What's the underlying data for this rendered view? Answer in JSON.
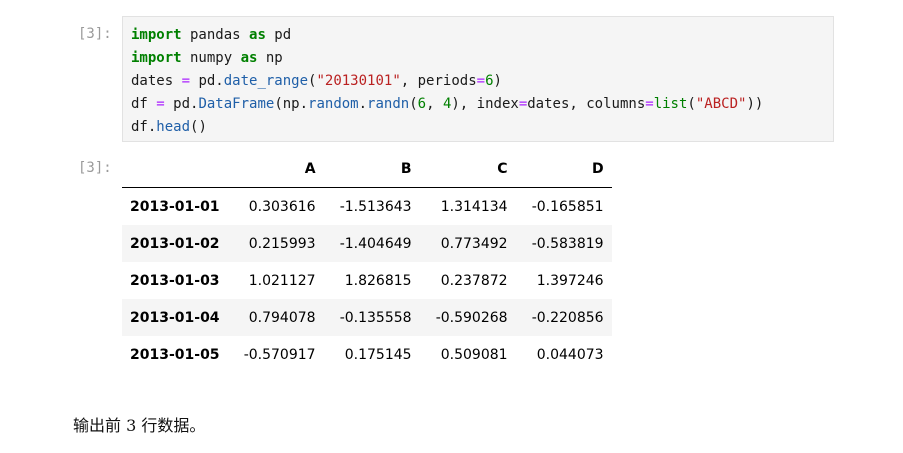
{
  "input_prompt": "[3]:",
  "output_prompt": "[3]:",
  "code": {
    "line1": {
      "k1": "import",
      "t1": " pandas ",
      "k2": "as",
      "t2": " pd"
    },
    "line2": {
      "k1": "import",
      "t1": " numpy ",
      "k2": "as",
      "t2": " np"
    },
    "line3": {
      "a": "dates ",
      "eq": "=",
      "b": " pd.",
      "fn": "date_range",
      "c": "(",
      "str": "\"20130101\"",
      "d": ", periods",
      "eq2": "=",
      "num": "6",
      "e": ")"
    },
    "line4": {
      "a": "df ",
      "eq": "=",
      "b": " pd.",
      "fn": "DataFrame",
      "c": "(np.",
      "fn2": "random",
      "d": ".",
      "fn3": "randn",
      "e": "(",
      "n1": "6",
      "f": ", ",
      "n2": "4",
      "g": "), index",
      "eq2": "=",
      "h": "dates, columns",
      "eq3": "=",
      "fn4": "list",
      "i": "(",
      "str": "\"ABCD\"",
      "j": "))"
    },
    "line5": {
      "a": "df.",
      "fn": "head",
      "b": "()"
    }
  },
  "table": {
    "columns": [
      "A",
      "B",
      "C",
      "D"
    ],
    "rows": [
      {
        "index": "2013-01-01",
        "values": [
          "0.303616",
          "-1.513643",
          "1.314134",
          "-0.165851"
        ]
      },
      {
        "index": "2013-01-02",
        "values": [
          "0.215993",
          "-1.404649",
          "0.773492",
          "-0.583819"
        ]
      },
      {
        "index": "2013-01-03",
        "values": [
          "1.021127",
          "1.826815",
          "0.237872",
          "1.397246"
        ]
      },
      {
        "index": "2013-01-04",
        "values": [
          "0.794078",
          "-0.135558",
          "-0.590268",
          "-0.220856"
        ]
      },
      {
        "index": "2013-01-05",
        "values": [
          "-0.570917",
          "0.175145",
          "0.509081",
          "0.044073"
        ]
      }
    ]
  },
  "caption": "输出前 3 行数据。"
}
